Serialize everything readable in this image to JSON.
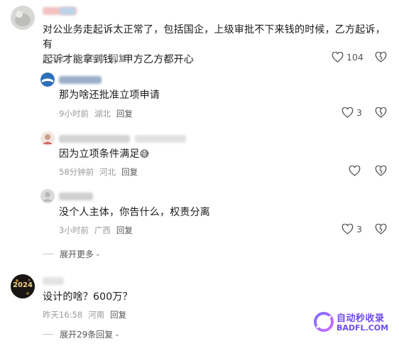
{
  "comments": [
    {
      "text_line1": "对公业务走起诉太正常了，包括国企，上级审批不下来钱的时候，乙方起诉，有",
      "text_line2": "起诉才能拿到钱，甲方乙方都开心",
      "time": "昨天23:12",
      "location": "河南",
      "reply": "回复",
      "likes": "104"
    },
    {
      "text": "那为啥还批准立项申请",
      "time": "9小时前",
      "location": "湖北",
      "reply": "回复",
      "likes": "3"
    },
    {
      "text": "因为立项条件满足",
      "emoji": "😅",
      "time": "58分钟前",
      "location": "河北",
      "reply": "回复",
      "likes": ""
    },
    {
      "text": "没个人主体，你告什么，权责分离",
      "time": "3小时前",
      "location": "广西",
      "reply": "回复",
      "likes": "3"
    },
    {
      "text": "设计的啥？600万？",
      "time": "昨天16:58",
      "location": "河南",
      "reply": "回复",
      "likes": ""
    }
  ],
  "expand_more": "展开更多",
  "expand_replies": "展开29条回复",
  "avatar_2024_text": "2024",
  "watermark": {
    "line1": "自动秒收录",
    "line2": "BADFL.COM"
  },
  "icons": {
    "like": "heart-outline-icon",
    "dislike": "broken-heart-icon",
    "chevron": "chevron-down-icon"
  }
}
